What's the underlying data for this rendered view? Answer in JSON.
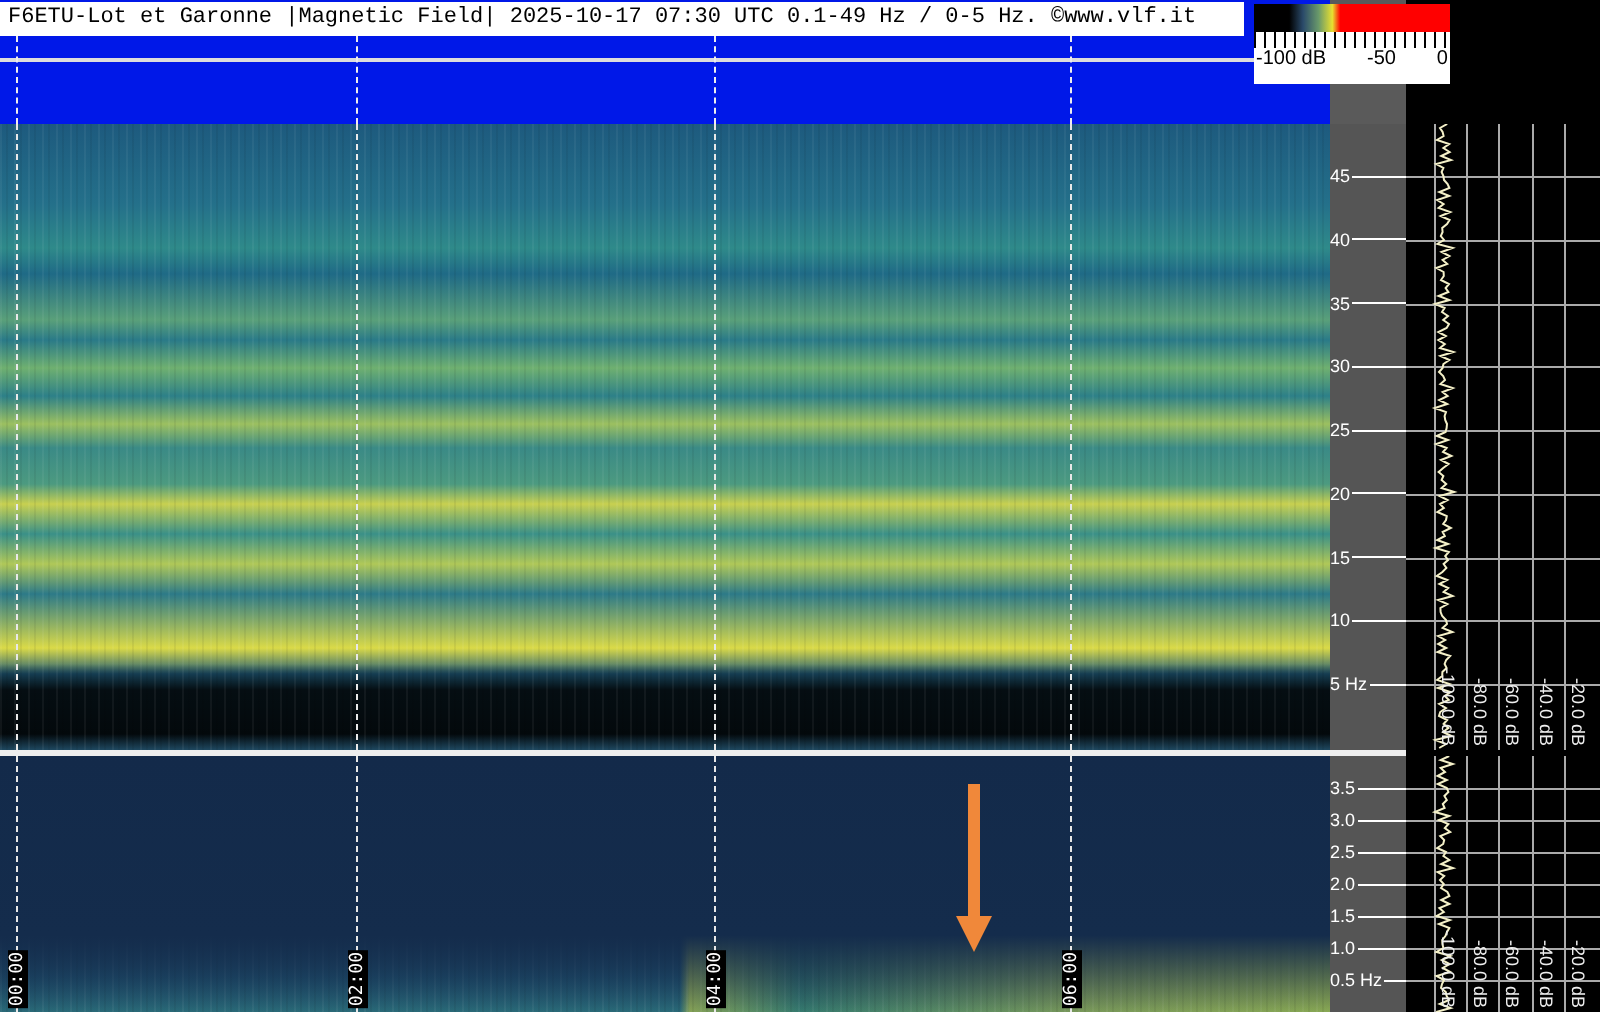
{
  "header": {
    "title": "F6ETU-Lot et Garonne |Magnetic Field| 2025-10-17 07:30 UTC 0.1-49 Hz / 0-5 Hz. ©www.vlf.it"
  },
  "color_scale": {
    "labels": [
      "-100 dB",
      "-50",
      "0"
    ]
  },
  "panels": [
    {
      "kind": "upper",
      "freq_ticks": [
        "45",
        "40",
        "35",
        "30",
        "25",
        "20",
        "15",
        "10",
        "5 Hz"
      ],
      "db_labels": [
        "-100.0 dB",
        "-80.0 dB",
        "-60.0 dB",
        "-40.0 dB",
        "-20.0 dB"
      ]
    },
    {
      "kind": "lower",
      "freq_ticks": [
        "3.5",
        "3.0",
        "2.5",
        "2.0",
        "1.5",
        "1.0",
        "0.5 Hz"
      ],
      "db_labels": [
        "-100.0 dB",
        "-80.0 dB",
        "-60.0 dB",
        "-40.0 dB",
        "-20.0 dB"
      ]
    }
  ],
  "time_labels": [
    "00:00",
    "02:00",
    "04:00",
    "06:00"
  ]
}
